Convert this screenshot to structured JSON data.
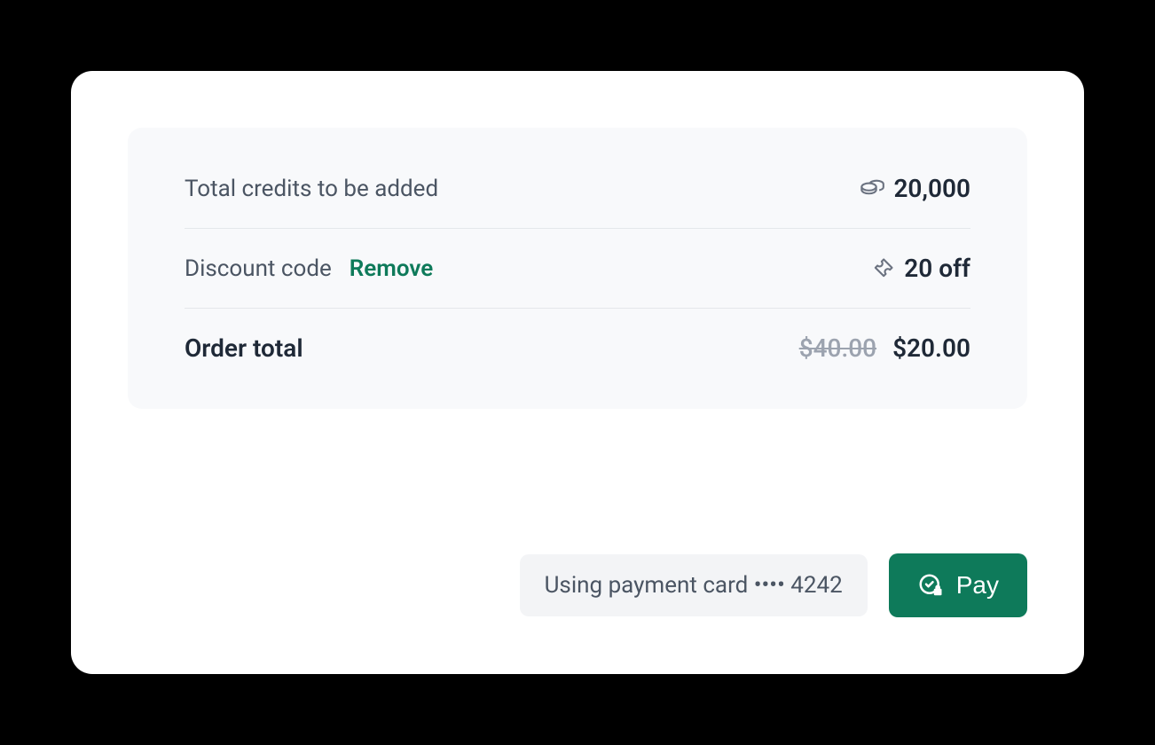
{
  "summary": {
    "credits": {
      "label": "Total credits to be added",
      "value": "20,000"
    },
    "discount": {
      "label": "Discount code",
      "remove": "Remove",
      "value": "20 off"
    },
    "order_total": {
      "label": "Order total",
      "original": "$40.00",
      "final": "$20.00"
    }
  },
  "footer": {
    "payment_card": "Using payment card •••• 4242",
    "pay_label": "Pay"
  }
}
